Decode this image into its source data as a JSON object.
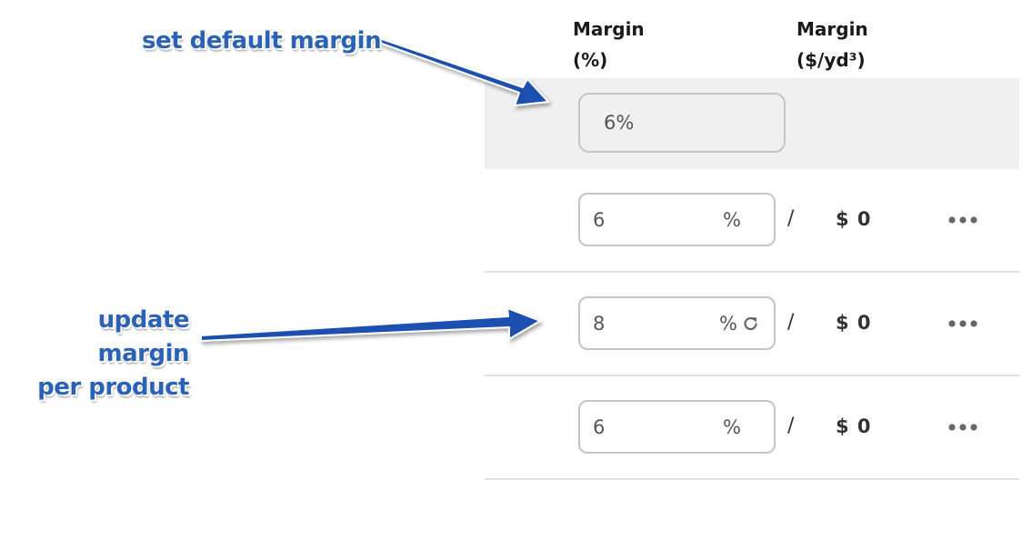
{
  "header": {
    "margin_pct_line1": "Margin",
    "margin_pct_line2": "(%)",
    "margin_usd_line1": "Margin",
    "margin_usd_line2": "($/yd³)"
  },
  "default_margin": {
    "value": "6%"
  },
  "rows": [
    {
      "value": "6",
      "unit": "%",
      "price": "$ 0",
      "reset_visible": false
    },
    {
      "value": "8",
      "unit": "%",
      "price": "$ 0",
      "reset_visible": true
    },
    {
      "value": "6",
      "unit": "%",
      "price": "$ 0",
      "reset_visible": false
    }
  ],
  "separator": "/",
  "annotations": {
    "set_default": "set default margin",
    "update_line1": "update margin",
    "update_line2": "per product"
  },
  "colors": {
    "annotation": "#2a62b8",
    "arrow": "#1d4fb0",
    "default_row_bg": "#f0f0f0",
    "input_border": "#c4c4c4"
  },
  "icons": [
    "reset-icon",
    "more-options-icon"
  ]
}
